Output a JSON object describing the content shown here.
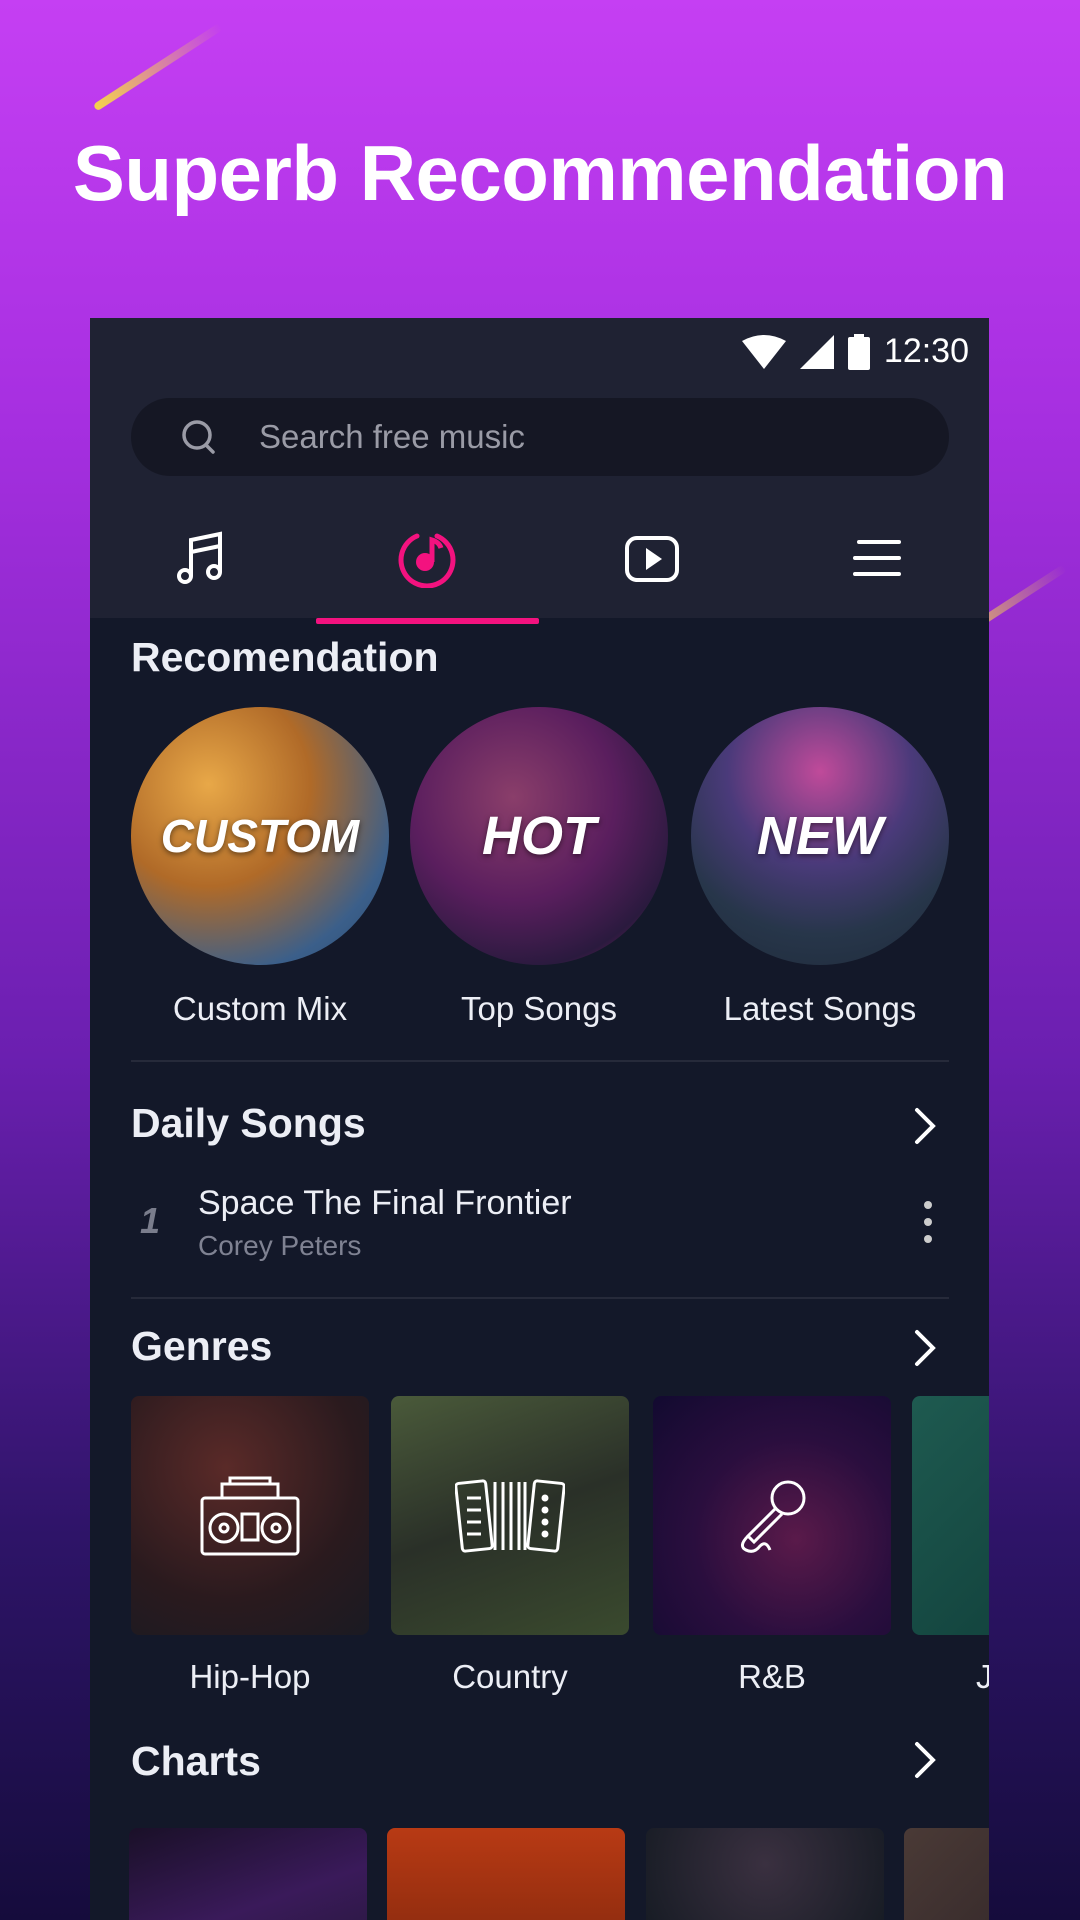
{
  "headline": "Superb Recommendation",
  "status_bar": {
    "time": "12:30",
    "icons": [
      "wifi-icon",
      "cell-signal-icon",
      "battery-icon"
    ]
  },
  "search": {
    "placeholder": "Search free music",
    "icon": "search-icon"
  },
  "tabs": [
    {
      "icon": "music-note-icon",
      "active": false
    },
    {
      "icon": "music-disc-icon",
      "active": true
    },
    {
      "icon": "video-play-icon",
      "active": false
    },
    {
      "icon": "menu-icon",
      "active": false
    }
  ],
  "colors": {
    "accent": "#f3127f",
    "background": "#131829",
    "header": "#1f2233"
  },
  "recommendation": {
    "title": "Recomendation",
    "items": [
      {
        "badge": "CUSTOM",
        "label": "Custom Mix"
      },
      {
        "badge": "HOT",
        "label": "Top Songs"
      },
      {
        "badge": "NEW",
        "label": "Latest Songs"
      }
    ]
  },
  "daily_songs": {
    "title": "Daily Songs",
    "songs": [
      {
        "rank": "1",
        "title": "Space The Final Frontier",
        "artist": "Corey Peters"
      }
    ]
  },
  "genres": {
    "title": "Genres",
    "items": [
      {
        "label": "Hip-Hop",
        "icon": "boombox-icon"
      },
      {
        "label": "Country",
        "icon": "accordion-icon"
      },
      {
        "label": "R&B",
        "icon": "microphone-icon"
      },
      {
        "label": "J"
      }
    ]
  },
  "charts": {
    "title": "Charts"
  }
}
